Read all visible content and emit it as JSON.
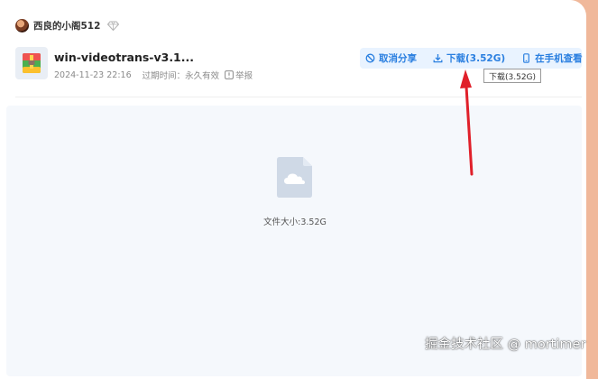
{
  "user": {
    "name": "西良的小阁512",
    "badge_icon": "diamond-icon"
  },
  "file": {
    "name": "win-videotrans-v3.1...",
    "date": "2024-11-23 22:16",
    "expiry": "过期时间：永久有效",
    "report_label": "举报",
    "icon": "archive-icon"
  },
  "actions": {
    "cancel_share": "取消分享",
    "download": "下载(3.52G)",
    "mobile_view": "在手机查看"
  },
  "tooltip": {
    "text": "下载(3.52G)"
  },
  "preview": {
    "size_text": "文件大小:3.52G",
    "icon": "cloud-file-icon"
  },
  "watermark": {
    "text": "掘金技术社区 @ mortimer"
  },
  "colors": {
    "accent": "#2a7fe0",
    "action_bg": "#e9f3ff",
    "background": "#f0b89a",
    "arrow": "#e0202a"
  }
}
